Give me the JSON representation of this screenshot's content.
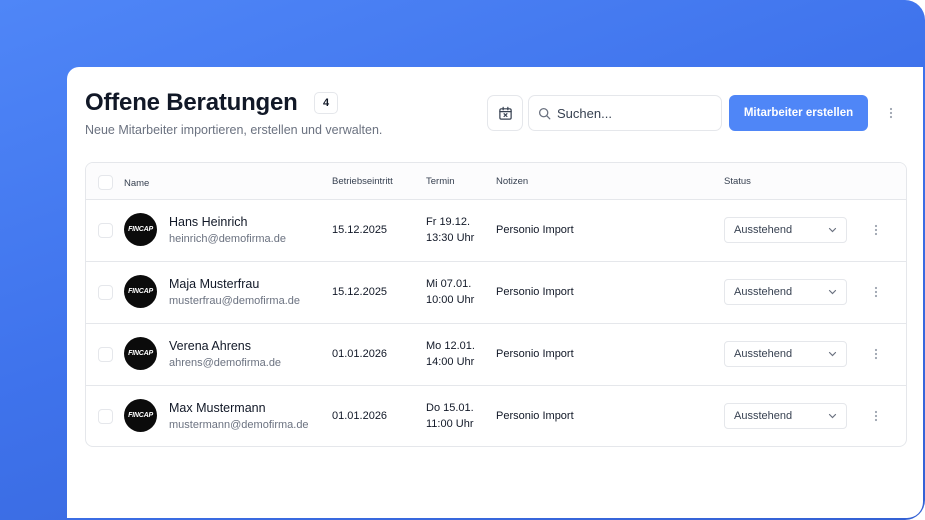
{
  "colors": {
    "accent": "#4f86f7",
    "text": "#111827",
    "muted": "#6b7280",
    "border": "#e5e7eb"
  },
  "header": {
    "title": "Offene Beratungen",
    "count": "4",
    "subtitle": "Neue Mitarbeiter importieren, erstellen und verwalten."
  },
  "toolbar": {
    "calendar_icon": "calendar-x-icon",
    "search_placeholder": "Suchen...",
    "search_value": "",
    "create_label": "Mitarbeiter erstellen",
    "more_icon": "vertical-dots-icon"
  },
  "table": {
    "columns": [
      "Name",
      "Betriebseintritt",
      "Termin",
      "Notizen",
      "Status"
    ],
    "rows": [
      {
        "avatar": "FINCAP",
        "name": "Hans Heinrich",
        "email": "heinrich@demofirma.de",
        "entry": "15.12.2025",
        "term_date": "Fr 19.12.",
        "term_time": "13:30 Uhr",
        "note": "Personio Import",
        "status": "Ausstehend"
      },
      {
        "avatar": "FINCAP",
        "name": "Maja Musterfrau",
        "email": "musterfrau@demofirma.de",
        "entry": "15.12.2025",
        "term_date": "Mi 07.01.",
        "term_time": "10:00 Uhr",
        "note": "Personio Import",
        "status": "Ausstehend"
      },
      {
        "avatar": "FINCAP",
        "name": "Verena Ahrens",
        "email": "ahrens@demofirma.de",
        "entry": "01.01.2026",
        "term_date": "Mo 12.01.",
        "term_time": "14:00 Uhr",
        "note": "Personio Import",
        "status": "Ausstehend"
      },
      {
        "avatar": "FINCAP",
        "name": "Max Mustermann",
        "email": "mustermann@demofirma.de",
        "entry": "01.01.2026",
        "term_date": "Do 15.01.",
        "term_time": "11:00 Uhr",
        "note": "Personio Import",
        "status": "Ausstehend"
      }
    ]
  }
}
